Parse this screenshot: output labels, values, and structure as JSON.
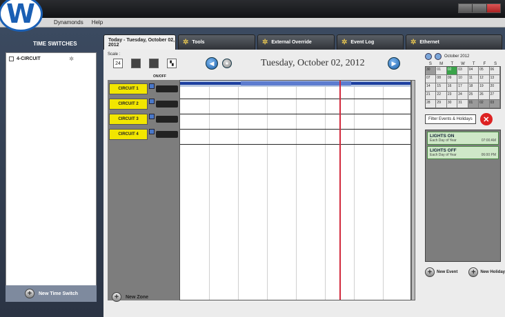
{
  "menubar": {
    "items": [
      "Dynamonds",
      "Help"
    ]
  },
  "sidebar": {
    "header": "TIME SWITCHES",
    "items": [
      {
        "label": "4-CIRCUIT",
        "star": "✲"
      }
    ],
    "footer_button": "New Time Switch"
  },
  "tabs": [
    {
      "label": "Today - Tuesday, October 02, 2012",
      "active": true
    },
    {
      "label": "Tools",
      "icon": "gear-icon"
    },
    {
      "label": "External Override",
      "icon": "gear-icon"
    },
    {
      "label": "Event Log",
      "icon": "gear-icon"
    },
    {
      "label": "Ethernet",
      "icon": "gear-icon"
    }
  ],
  "schedule": {
    "scale_label": "Scale :",
    "date_title": "Tuesday, October 02, 2012",
    "zone_header": "ON/OFF",
    "zones": [
      "CIRCUIT 1",
      "CIRCUIT 2",
      "CIRCUIT 3",
      "CIRCUIT 4"
    ],
    "new_zone": "New Zone"
  },
  "calendar": {
    "month": "October 2012",
    "dow": [
      "S",
      "M",
      "T",
      "W",
      "T",
      "F",
      "S"
    ],
    "days": [
      "30",
      "01",
      "02",
      "03",
      "04",
      "05",
      "06",
      "07",
      "08",
      "09",
      "10",
      "11",
      "12",
      "13",
      "14",
      "15",
      "16",
      "17",
      "18",
      "19",
      "20",
      "21",
      "22",
      "23",
      "24",
      "25",
      "26",
      "27",
      "28",
      "29",
      "30",
      "31",
      "01",
      "02",
      "03"
    ]
  },
  "filter_button": "Filter Events & Holidays",
  "events": [
    {
      "title": "LIGHTS ON",
      "sub": "Each Day of Year",
      "time": "07:00 AM"
    },
    {
      "title": "LIGHTS OFF",
      "sub": "Each Day of Year",
      "time": "06:00 PM"
    }
  ],
  "footer": {
    "new_event": "New Event",
    "new_holiday": "New Holiday"
  },
  "colors": {
    "zone_label": "#f2e600",
    "current_time": "#d2283c",
    "today": "#3aa44a",
    "event_bg": "#cfe8c8"
  }
}
